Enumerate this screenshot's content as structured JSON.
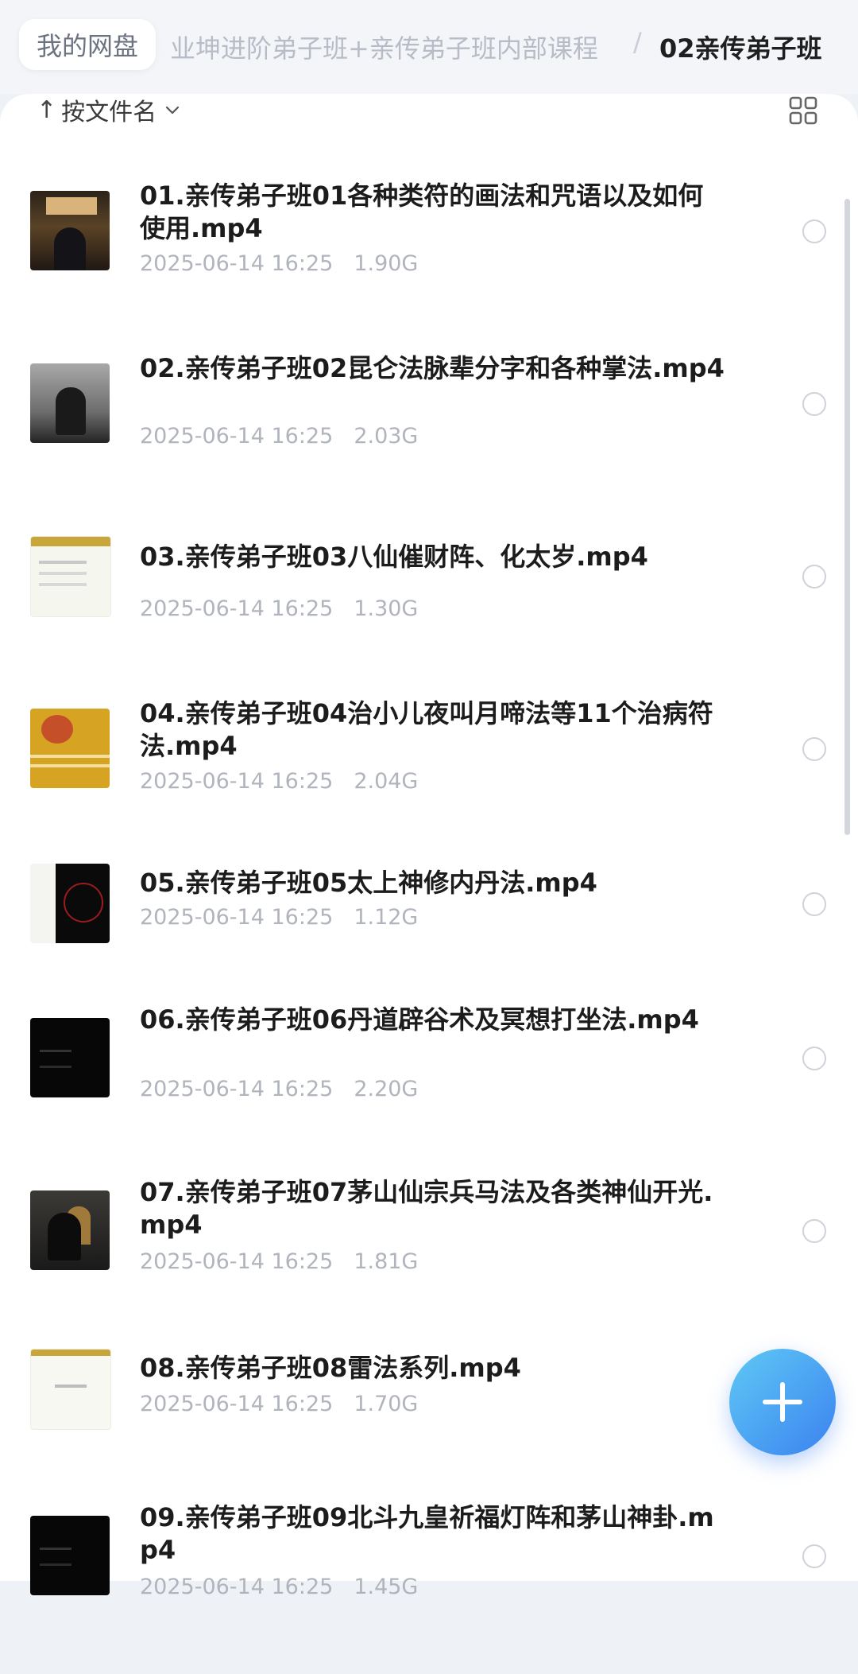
{
  "breadcrumb": {
    "home": "我的网盘",
    "middle": "业坤进阶弟子班+亲传弟子班内部课程",
    "separator": "/",
    "current": "02亲传弟子班"
  },
  "toolbar": {
    "sort_arrow": "↑",
    "sort_label": "按文件名",
    "sort_icon": "chevron-down-icon",
    "view_icon": "grid-view-icon"
  },
  "files": [
    {
      "name": "01.亲传弟子班01各种类符的画法和咒语以及如何使用.mp4",
      "date": "2025-06-14 16:25",
      "size": "1.90G"
    },
    {
      "name": "02.亲传弟子班02昆仑法脉辈分字和各种掌法.mp4",
      "date": "2025-06-14 16:25",
      "size": "2.03G"
    },
    {
      "name": "03.亲传弟子班03八仙催财阵、化太岁.mp4",
      "date": "2025-06-14 16:25",
      "size": "1.30G"
    },
    {
      "name": "04.亲传弟子班04治小儿夜叫月啼法等11个治病符法.mp4",
      "date": "2025-06-14 16:25",
      "size": "2.04G"
    },
    {
      "name": "05.亲传弟子班05太上神修内丹法.mp4",
      "date": "2025-06-14 16:25",
      "size": "1.12G"
    },
    {
      "name": "06.亲传弟子班06丹道辟谷术及冥想打坐法.mp4",
      "date": "2025-06-14 16:25",
      "size": "2.20G"
    },
    {
      "name": "07.亲传弟子班07茅山仙宗兵马法及各类神仙开光.mp4",
      "date": "2025-06-14 16:25",
      "size": "1.81G"
    },
    {
      "name": "08.亲传弟子班08雷法系列.mp4",
      "date": "2025-06-14 16:25",
      "size": "1.70G"
    },
    {
      "name": "09.亲传弟子班09北斗九皇祈福灯阵和茅山神卦.mp4",
      "date": "2025-06-14 16:25",
      "size": "1.45G"
    }
  ],
  "fab": {
    "icon": "plus-icon"
  },
  "colors": {
    "accent": "#3b82f0",
    "accent_light": "#5fc9f5",
    "meta_text": "#b0b4bc"
  }
}
